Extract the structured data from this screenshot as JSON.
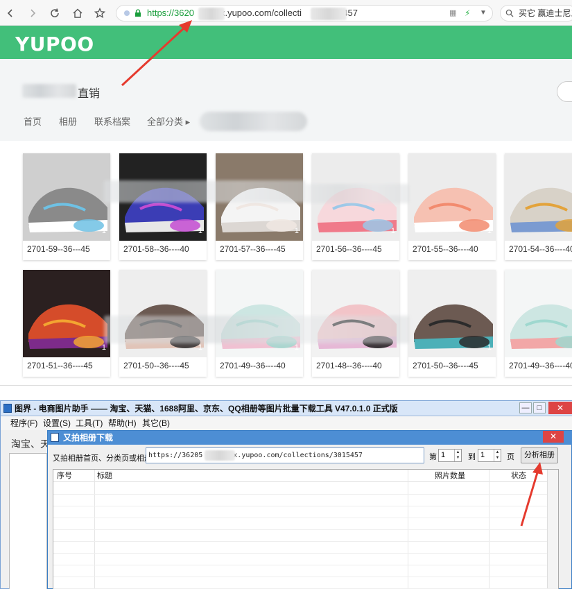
{
  "browser": {
    "url_prefix": "https://3620",
    "url_mid": "x.yupoo.com/collecti",
    "url_end": "5457",
    "right_text": "买它  赢迪士尼三"
  },
  "site": {
    "logo": "YUPOO",
    "store_suffix": "直销",
    "nav": [
      "首页",
      "相册",
      "联系档案",
      "全部分类 ▸"
    ]
  },
  "albums": [
    {
      "label": "2701-59--36---45",
      "count": "1"
    },
    {
      "label": "2701-58--36----40",
      "count": "1"
    },
    {
      "label": "2701-57--36----45",
      "count": "1"
    },
    {
      "label": "2701-56--36----45",
      "count": "1"
    },
    {
      "label": "2701-55--36----40",
      "count": "1"
    },
    {
      "label": "2701-54--36----40",
      "count": "1"
    },
    {
      "label": "2701-51--36----45",
      "count": "1"
    },
    {
      "label": "2701-50--36----45",
      "count": "1"
    },
    {
      "label": "2701-49--36----40",
      "count": "1"
    },
    {
      "label": "2701-48--36----40",
      "count": ""
    },
    {
      "label": "2701-50--36----45",
      "count": "1"
    },
    {
      "label": "2701-49--36----40",
      "count": "1"
    }
  ],
  "app": {
    "title": "图界 - 电商图片助手 —— 淘宝、天猫、1688阿里、京东、QQ相册等图片批量下载工具 V47.0.1.0 正式版",
    "menu": [
      "程序(F)",
      "设置(S)",
      "工具(T)",
      "帮助(H)",
      "其它(B)"
    ],
    "tab_text": "淘宝、天"
  },
  "dialog": {
    "title": "又拍相册下载",
    "url_label": "又拍相册首页、分类页或相册页:",
    "url_value_a": "https://36205",
    "url_value_b": "x.yupoo.com/collections/3015457",
    "page_from_label": "第",
    "page_from": "1",
    "page_to_label": "到",
    "page_to": "1",
    "page_unit": "页",
    "analyze_button": "分析相册",
    "columns": [
      "序号",
      "标题",
      "照片数量",
      "状态"
    ]
  },
  "colors": {
    "yupoo_green": "#42bf7a",
    "arrow_red": "#e53a2e",
    "dialog_blue": "#4d8ed4"
  }
}
